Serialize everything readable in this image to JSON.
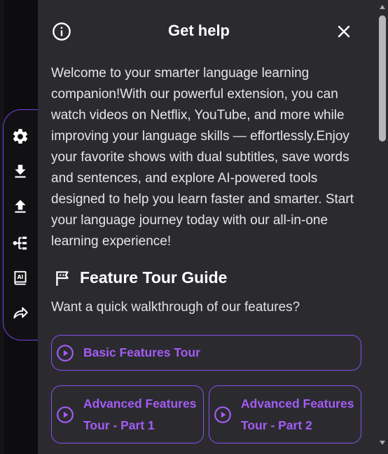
{
  "toolbar": {
    "items": [
      {
        "name": "settings",
        "icon": "gear-icon"
      },
      {
        "name": "download",
        "icon": "download-icon"
      },
      {
        "name": "upload",
        "icon": "upload-icon"
      },
      {
        "name": "tree",
        "icon": "tree-icon"
      },
      {
        "name": "ai-book",
        "icon": "ai-book-icon"
      },
      {
        "name": "share",
        "icon": "share-icon"
      }
    ]
  },
  "panel": {
    "title": "Get help",
    "info_icon": "info-icon",
    "close_icon": "close-icon",
    "intro": "Welcome to your smarter language learning companion!With our powerful extension, you can watch videos on Netflix, YouTube, and more while improving your language skills — effortlessly.Enjoy your favorite shows with dual subtitles, save words and sentences, and explore AI-powered tools designed to help you learn faster and smarter. Start your language journey today with our all-in-one learning experience!",
    "section": {
      "icon": "flag-icon",
      "title": "Feature Tour Guide",
      "subtitle": "Want a quick walkthrough of our features?"
    },
    "tours": {
      "basic": "Basic Features Tour",
      "advanced_1": {
        "line1": "Advanced Features",
        "line2": "Tour - Part 1"
      },
      "advanced_2": {
        "line1": "Advanced Features",
        "line2": "Tour - Part 2"
      }
    }
  },
  "colors": {
    "accent": "#8a4ff0",
    "accent_text": "#a45cf5",
    "panel_bg": "#2b2b2f",
    "page_bg": "#0c0c0e"
  }
}
